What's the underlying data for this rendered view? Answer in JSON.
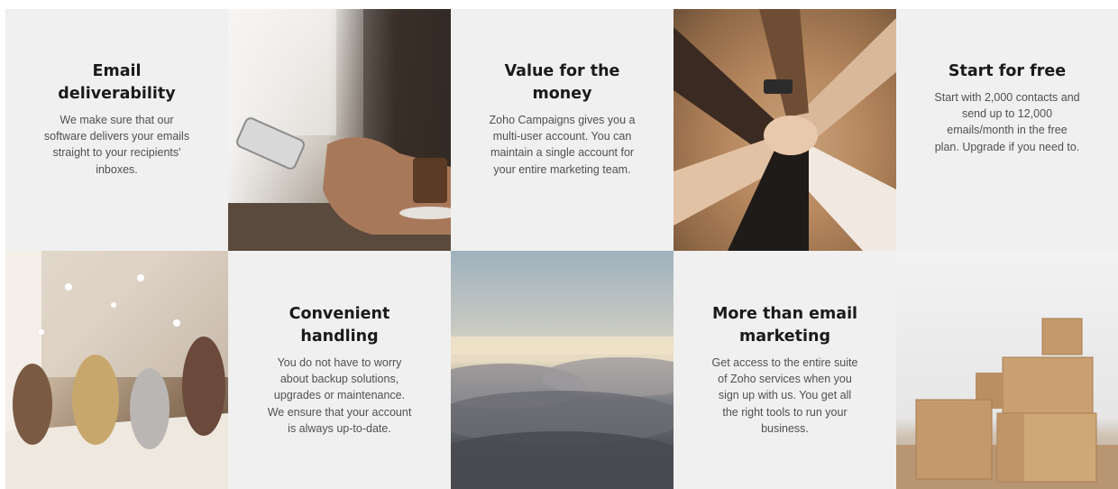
{
  "tiles": [
    {
      "title": "Email\ndeliverability",
      "text": "We make sure that our\nsoftware delivers your emails\nstraight to your recipients'\ninboxes."
    },
    {
      "title": "Value for the\nmoney",
      "text": "Zoho Campaigns gives you a\nmulti-user account. You can\nmaintain a single account for\nyour entire marketing team."
    },
    {
      "title": "Start for free",
      "text": "Start with 2,000 contacts and\nsend up to 12,000\nemails/month in the free\nplan. Upgrade if you need to."
    },
    {
      "title": "Convenient\nhandling",
      "text": "You do not have to worry\nabout backup solutions,\nupgrades or maintenance.\nWe ensure that your account\nis always up-to-date."
    },
    {
      "title": "More than email\nmarketing",
      "text": "Get access to the entire suite\nof Zoho services when you\nsign up with us. You get all\nthe right tools to run your\nbusiness."
    }
  ],
  "photos": [
    {
      "name": "photo-hand-holding-phone"
    },
    {
      "name": "photo-team-hands-stacked"
    },
    {
      "name": "photo-team-celebrating"
    },
    {
      "name": "photo-clouds-sunrise"
    },
    {
      "name": "photo-cardboard-boxes"
    }
  ]
}
